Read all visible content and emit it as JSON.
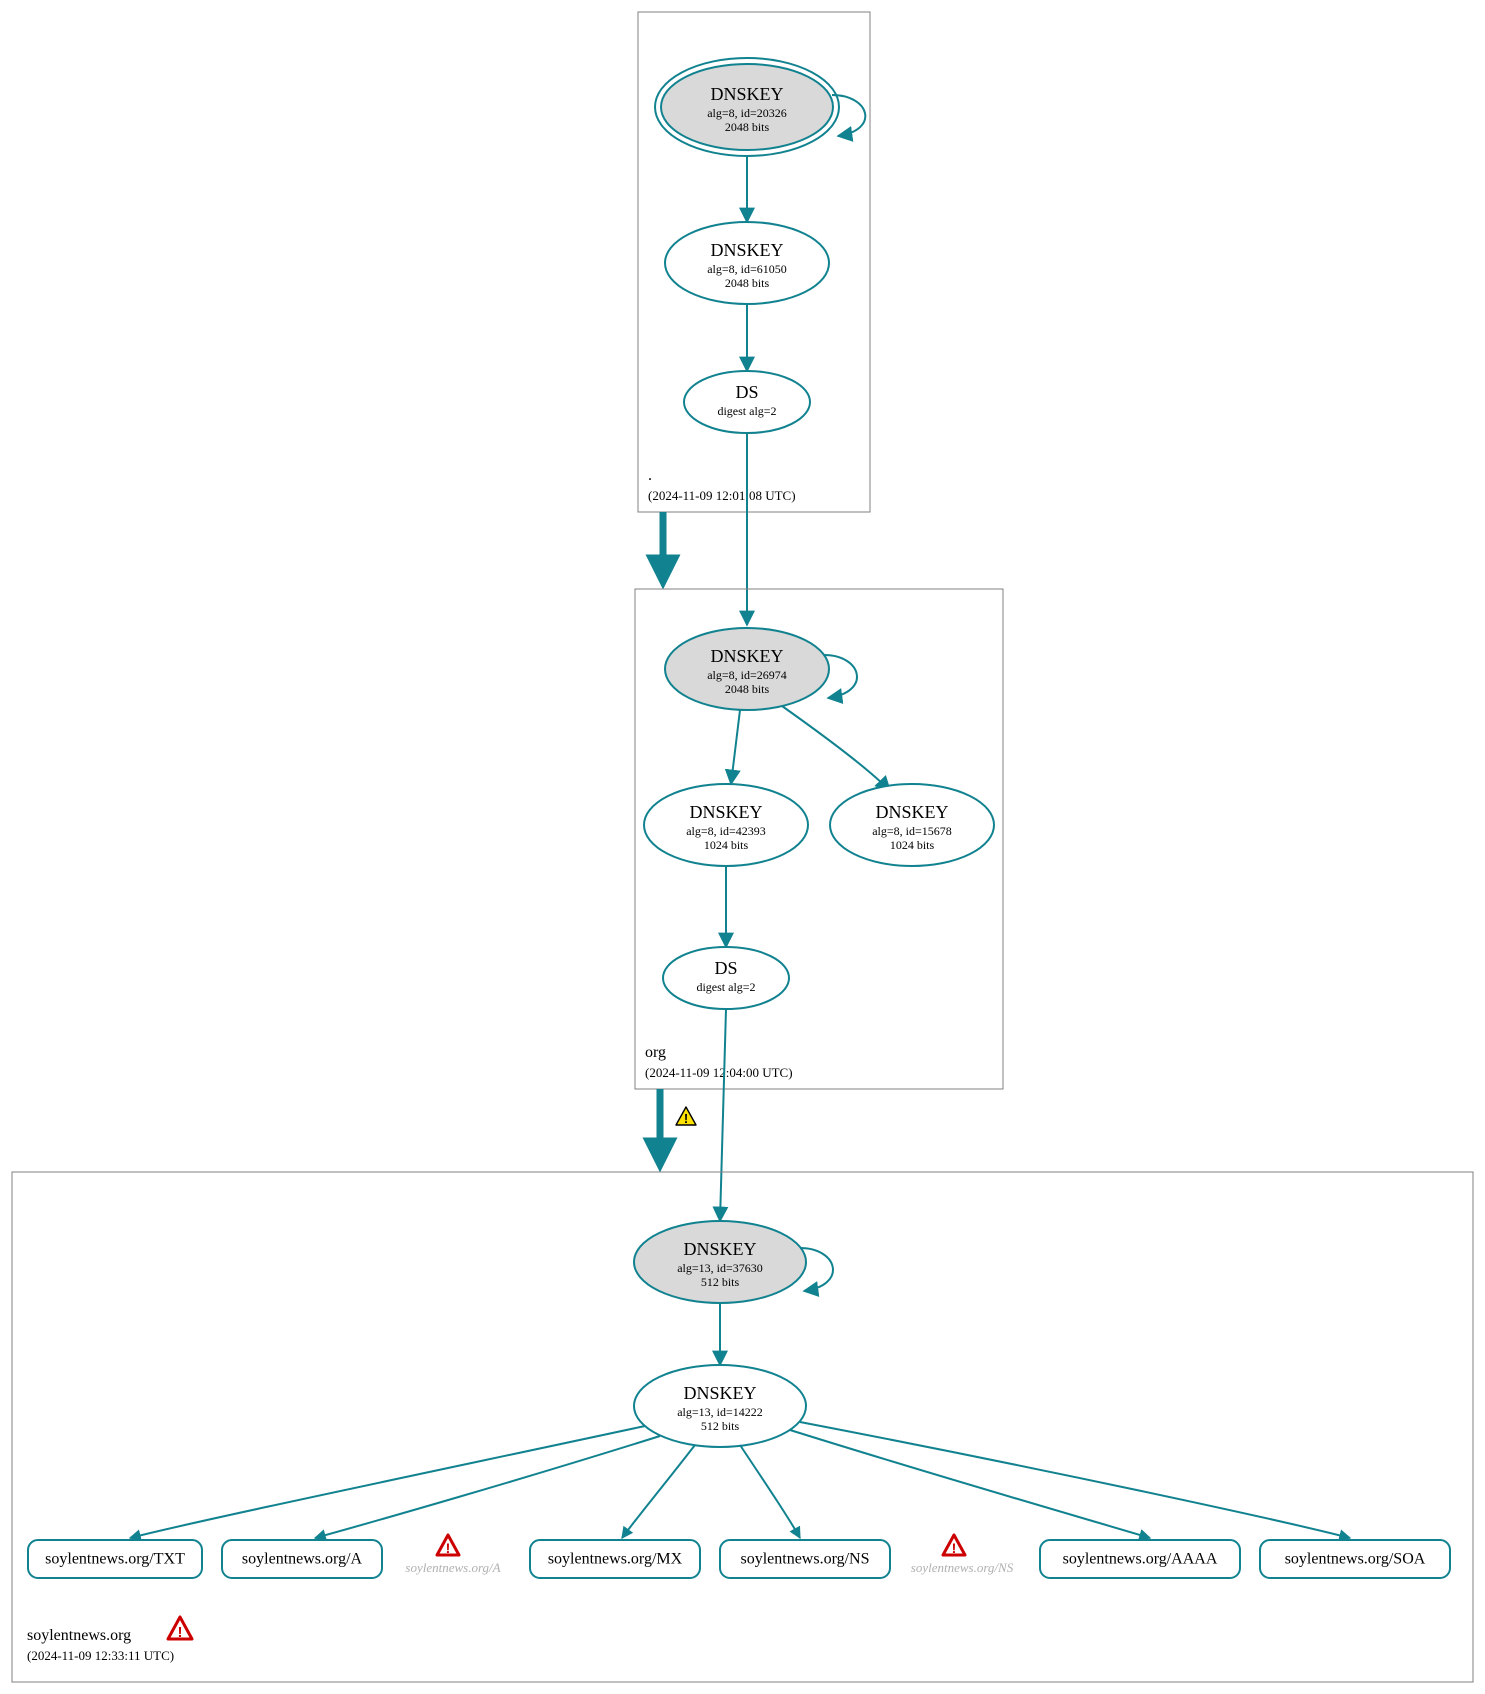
{
  "colors": {
    "teal": "#11828f",
    "nodeGrey": "#d9d9d9",
    "warnYellowFill": "#ffe100",
    "warnYellowStroke": "#000000",
    "warnRedFill": "#ffffff",
    "warnRedStroke": "#cc0000"
  },
  "zones": {
    "root": {
      "label": ".",
      "timestamp": "(2024-11-09 12:01:08 UTC)"
    },
    "org": {
      "label": "org",
      "timestamp": "(2024-11-09 12:04:00 UTC)"
    },
    "soylent": {
      "label": "soylentnews.org",
      "timestamp": "(2024-11-09 12:33:11 UTC)"
    }
  },
  "nodes": {
    "root_ksk": {
      "title": "DNSKEY",
      "line1": "alg=8, id=20326",
      "line2": "2048 bits"
    },
    "root_zsk": {
      "title": "DNSKEY",
      "line1": "alg=8, id=61050",
      "line2": "2048 bits"
    },
    "root_ds": {
      "title": "DS",
      "line1": "digest alg=2",
      "line2": ""
    },
    "org_ksk": {
      "title": "DNSKEY",
      "line1": "alg=8, id=26974",
      "line2": "2048 bits"
    },
    "org_zska": {
      "title": "DNSKEY",
      "line1": "alg=8, id=42393",
      "line2": "1024 bits"
    },
    "org_zskb": {
      "title": "DNSKEY",
      "line1": "alg=8, id=15678",
      "line2": "1024 bits"
    },
    "org_ds": {
      "title": "DS",
      "line1": "digest alg=2",
      "line2": ""
    },
    "soy_ksk": {
      "title": "DNSKEY",
      "line1": "alg=13, id=37630",
      "line2": "512 bits"
    },
    "soy_zsk": {
      "title": "DNSKEY",
      "line1": "alg=13, id=14222",
      "line2": "512 bits"
    }
  },
  "rr": {
    "txt": "soylentnews.org/TXT",
    "a": "soylentnews.org/A",
    "mx": "soylentnews.org/MX",
    "ns": "soylentnews.org/NS",
    "aaaa": "soylentnews.org/AAAA",
    "soa": "soylentnews.org/SOA"
  },
  "ghost": {
    "a": "soylentnews.org/A",
    "ns": "soylentnews.org/NS"
  }
}
